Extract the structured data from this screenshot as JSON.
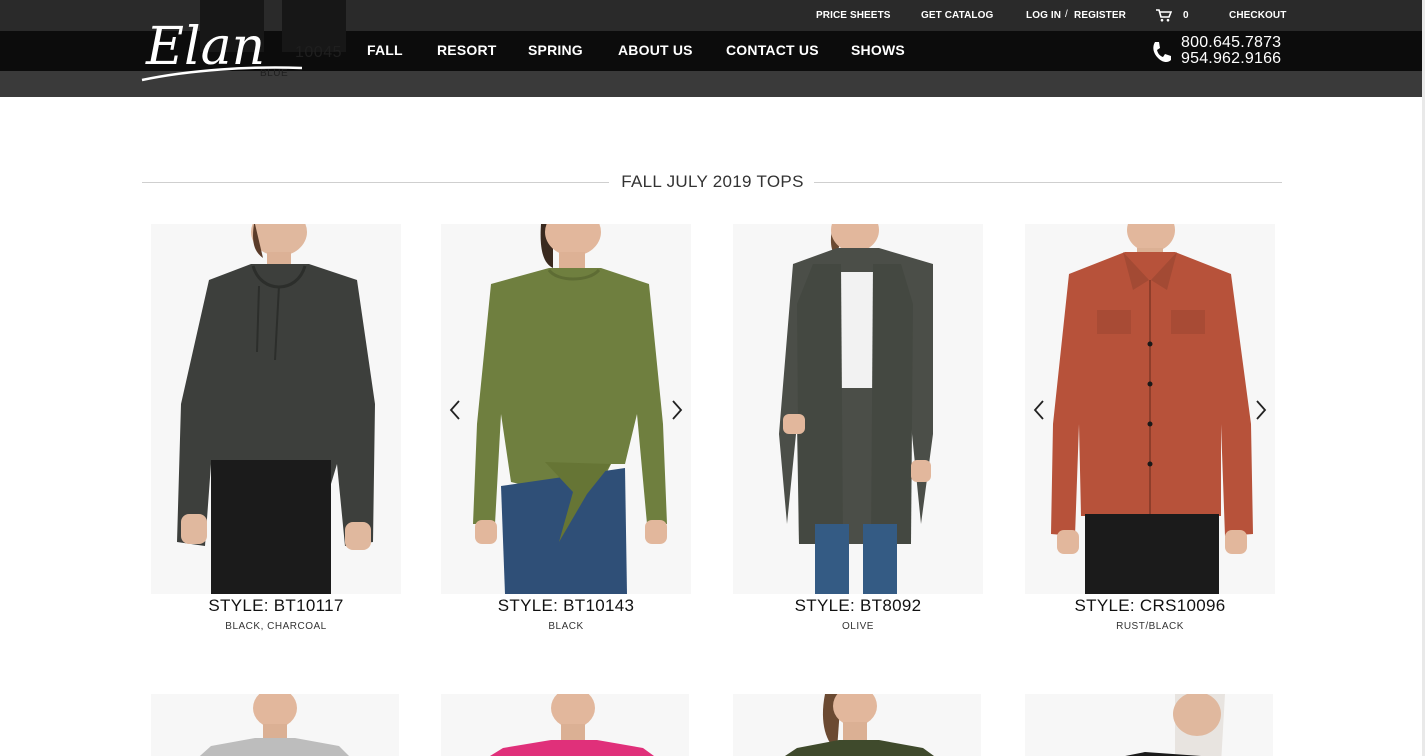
{
  "header": {
    "ghost_product_code": "10045",
    "ghost_product_color": "BLUE",
    "utility_links": {
      "price_sheets": "PRICE SHEETS",
      "get_catalog": "GET CATALOG",
      "log_in": "LOG IN",
      "separator": "/",
      "register": "REGISTER",
      "cart_count": "0",
      "checkout": "CHECKOUT"
    },
    "nav": [
      "FALL",
      "RESORT",
      "SPRING",
      "ABOUT US",
      "CONTACT US",
      "SHOWS"
    ],
    "phones": [
      "800.645.7873",
      "954.962.9166"
    ],
    "logo_text": "Elan"
  },
  "section": {
    "title": "FALL JULY 2019 TOPS"
  },
  "products": [
    {
      "style": "STYLE: BT10117",
      "colors": "BLACK, CHARCOAL"
    },
    {
      "style": "STYLE: BT10143",
      "colors": "BLACK"
    },
    {
      "style": "STYLE: BT8092",
      "colors": "OLIVE"
    },
    {
      "style": "STYLE: CRS10096",
      "colors": "RUST/BLACK"
    }
  ],
  "theme": {
    "header_bg": "#3a3a3a",
    "nav_bg": "#0c0c0c",
    "accent": "#ffffff"
  },
  "icons": [
    "cart-icon",
    "phone-icon",
    "chevron-left-icon",
    "chevron-right-icon"
  ]
}
